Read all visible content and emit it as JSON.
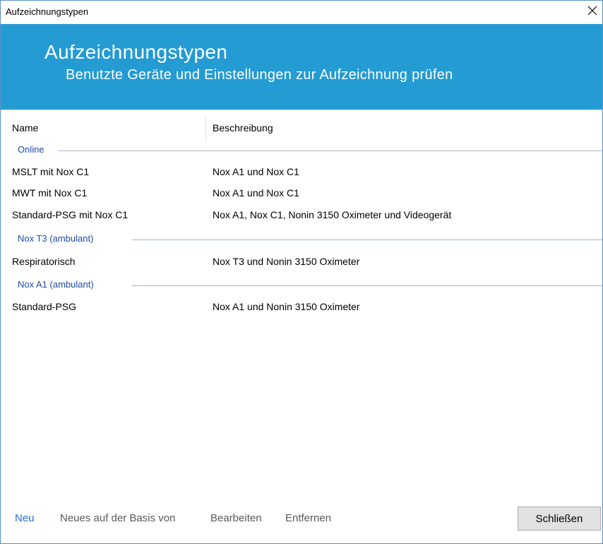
{
  "window": {
    "title": "Aufzeichnungstypen"
  },
  "banner": {
    "title": "Aufzeichnungstypen",
    "subtitle": "Benutzte Geräte und Einstellungen zur Aufzeichnung prüfen",
    "color": "#249bd3"
  },
  "list": {
    "columns": [
      "Name",
      "Beschreibung"
    ],
    "groups": [
      {
        "label": "Online",
        "rows": [
          {
            "name": "MSLT mit Nox C1",
            "description": "Nox A1 und Nox C1"
          },
          {
            "name": "MWT mit Nox C1",
            "description": "Nox A1 und Nox C1"
          },
          {
            "name": "Standard-PSG mit Nox C1",
            "description": "Nox A1, Nox C1, Nonin 3150 Oximeter und Videogerät"
          }
        ]
      },
      {
        "label": "Nox T3 (ambulant)",
        "rows": [
          {
            "name": "Respiratorisch",
            "description": "Nox T3 und Nonin 3150 Oximeter"
          }
        ]
      },
      {
        "label": "Nox A1 (ambulant)",
        "rows": [
          {
            "name": "Standard-PSG",
            "description": "Nox A1 und Nonin 3150 Oximeter"
          }
        ]
      }
    ]
  },
  "footer": {
    "actions": [
      "Neu",
      "Neues auf der Basis von",
      "Bearbeiten",
      "Entfernen"
    ],
    "close_label": "Schließen"
  },
  "icons": {
    "close": "close-icon"
  }
}
